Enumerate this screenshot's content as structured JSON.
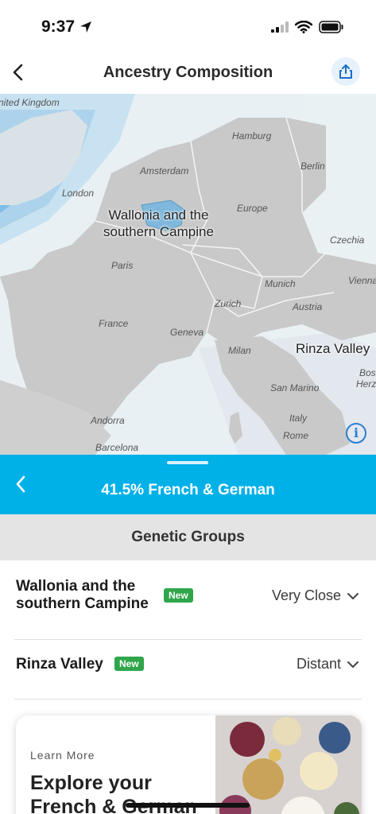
{
  "status_bar": {
    "time": "9:37",
    "location_icon": "location-arrow-icon",
    "signal_icon": "signal-icon",
    "wifi_icon": "wifi-icon",
    "battery_icon": "battery-icon"
  },
  "header": {
    "title": "Ancestry Composition",
    "back_icon": "chevron-left-icon",
    "share_icon": "share-icon"
  },
  "map": {
    "labels": {
      "united_kingdom": "nited Kingdom",
      "hamburg": "Hamburg",
      "berlin": "Berlin",
      "amsterdam": "Amsterdam",
      "london": "London",
      "europe": "Europe",
      "czechia": "Czechia",
      "paris": "Paris",
      "munich": "Munich",
      "vienna": "Vienna",
      "zurich": "Zurich",
      "austria": "Austria",
      "france": "France",
      "geneva": "Geneva",
      "milan": "Milan",
      "bosnia": "Bos",
      "herz": "Herz",
      "san_marino": "San Marino",
      "andorra": "Andorra",
      "italy": "Italy",
      "rome": "Rome",
      "barcelona": "Barcelona"
    },
    "highlight_labels": {
      "wallonia_line1": "Wallonia and the",
      "wallonia_line2": "southern Campine",
      "rinza": "Rinza Valley"
    },
    "info_icon": "info-icon"
  },
  "sheet": {
    "title": "41.5% French & German",
    "section_title": "Genetic Groups",
    "groups": [
      {
        "name_line1": "Wallonia and the",
        "name_line2": "southern Campine",
        "badge": "New",
        "relation": "Very Close"
      },
      {
        "name_line1": "Rinza Valley",
        "name_line2": "",
        "badge": "New",
        "relation": "Distant"
      }
    ]
  },
  "card": {
    "eyebrow": "Learn More",
    "headline": "Explore your French & German"
  },
  "colors": {
    "accent": "#00b1e8",
    "badge": "#2fa64a",
    "highlight_region": "#7fb8dc"
  }
}
